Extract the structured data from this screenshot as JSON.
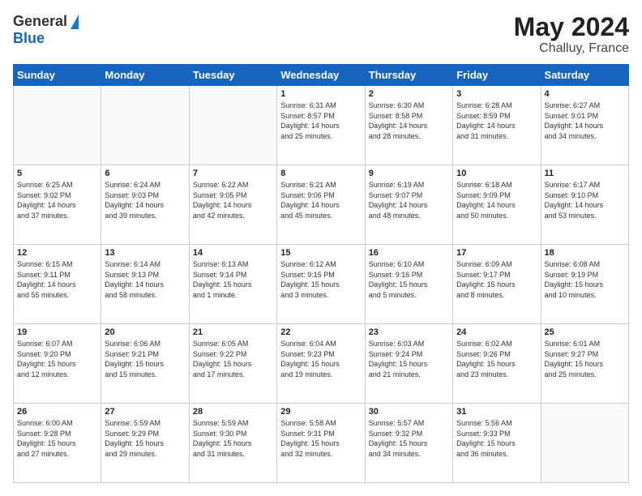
{
  "header": {
    "logo_general": "General",
    "logo_blue": "Blue",
    "month_year": "May 2024",
    "location": "Challuy, France"
  },
  "weekdays": [
    "Sunday",
    "Monday",
    "Tuesday",
    "Wednesday",
    "Thursday",
    "Friday",
    "Saturday"
  ],
  "weeks": [
    [
      {
        "day": "",
        "info": ""
      },
      {
        "day": "",
        "info": ""
      },
      {
        "day": "",
        "info": ""
      },
      {
        "day": "1",
        "info": "Sunrise: 6:31 AM\nSunset: 8:57 PM\nDaylight: 14 hours\nand 25 minutes."
      },
      {
        "day": "2",
        "info": "Sunrise: 6:30 AM\nSunset: 8:58 PM\nDaylight: 14 hours\nand 28 minutes."
      },
      {
        "day": "3",
        "info": "Sunrise: 6:28 AM\nSunset: 8:59 PM\nDaylight: 14 hours\nand 31 minutes."
      },
      {
        "day": "4",
        "info": "Sunrise: 6:27 AM\nSunset: 9:01 PM\nDaylight: 14 hours\nand 34 minutes."
      }
    ],
    [
      {
        "day": "5",
        "info": "Sunrise: 6:25 AM\nSunset: 9:02 PM\nDaylight: 14 hours\nand 37 minutes."
      },
      {
        "day": "6",
        "info": "Sunrise: 6:24 AM\nSunset: 9:03 PM\nDaylight: 14 hours\nand 39 minutes."
      },
      {
        "day": "7",
        "info": "Sunrise: 6:22 AM\nSunset: 9:05 PM\nDaylight: 14 hours\nand 42 minutes."
      },
      {
        "day": "8",
        "info": "Sunrise: 6:21 AM\nSunset: 9:06 PM\nDaylight: 14 hours\nand 45 minutes."
      },
      {
        "day": "9",
        "info": "Sunrise: 6:19 AM\nSunset: 9:07 PM\nDaylight: 14 hours\nand 48 minutes."
      },
      {
        "day": "10",
        "info": "Sunrise: 6:18 AM\nSunset: 9:09 PM\nDaylight: 14 hours\nand 50 minutes."
      },
      {
        "day": "11",
        "info": "Sunrise: 6:17 AM\nSunset: 9:10 PM\nDaylight: 14 hours\nand 53 minutes."
      }
    ],
    [
      {
        "day": "12",
        "info": "Sunrise: 6:15 AM\nSunset: 9:11 PM\nDaylight: 14 hours\nand 55 minutes."
      },
      {
        "day": "13",
        "info": "Sunrise: 6:14 AM\nSunset: 9:13 PM\nDaylight: 14 hours\nand 58 minutes."
      },
      {
        "day": "14",
        "info": "Sunrise: 6:13 AM\nSunset: 9:14 PM\nDaylight: 15 hours\nand 1 minute."
      },
      {
        "day": "15",
        "info": "Sunrise: 6:12 AM\nSunset: 9:15 PM\nDaylight: 15 hours\nand 3 minutes."
      },
      {
        "day": "16",
        "info": "Sunrise: 6:10 AM\nSunset: 9:16 PM\nDaylight: 15 hours\nand 5 minutes."
      },
      {
        "day": "17",
        "info": "Sunrise: 6:09 AM\nSunset: 9:17 PM\nDaylight: 15 hours\nand 8 minutes."
      },
      {
        "day": "18",
        "info": "Sunrise: 6:08 AM\nSunset: 9:19 PM\nDaylight: 15 hours\nand 10 minutes."
      }
    ],
    [
      {
        "day": "19",
        "info": "Sunrise: 6:07 AM\nSunset: 9:20 PM\nDaylight: 15 hours\nand 12 minutes."
      },
      {
        "day": "20",
        "info": "Sunrise: 6:06 AM\nSunset: 9:21 PM\nDaylight: 15 hours\nand 15 minutes."
      },
      {
        "day": "21",
        "info": "Sunrise: 6:05 AM\nSunset: 9:22 PM\nDaylight: 15 hours\nand 17 minutes."
      },
      {
        "day": "22",
        "info": "Sunrise: 6:04 AM\nSunset: 9:23 PM\nDaylight: 15 hours\nand 19 minutes."
      },
      {
        "day": "23",
        "info": "Sunrise: 6:03 AM\nSunset: 9:24 PM\nDaylight: 15 hours\nand 21 minutes."
      },
      {
        "day": "24",
        "info": "Sunrise: 6:02 AM\nSunset: 9:26 PM\nDaylight: 15 hours\nand 23 minutes."
      },
      {
        "day": "25",
        "info": "Sunrise: 6:01 AM\nSunset: 9:27 PM\nDaylight: 15 hours\nand 25 minutes."
      }
    ],
    [
      {
        "day": "26",
        "info": "Sunrise: 6:00 AM\nSunset: 9:28 PM\nDaylight: 15 hours\nand 27 minutes."
      },
      {
        "day": "27",
        "info": "Sunrise: 5:59 AM\nSunset: 9:29 PM\nDaylight: 15 hours\nand 29 minutes."
      },
      {
        "day": "28",
        "info": "Sunrise: 5:59 AM\nSunset: 9:30 PM\nDaylight: 15 hours\nand 31 minutes."
      },
      {
        "day": "29",
        "info": "Sunrise: 5:58 AM\nSunset: 9:31 PM\nDaylight: 15 hours\nand 32 minutes."
      },
      {
        "day": "30",
        "info": "Sunrise: 5:57 AM\nSunset: 9:32 PM\nDaylight: 15 hours\nand 34 minutes."
      },
      {
        "day": "31",
        "info": "Sunrise: 5:56 AM\nSunset: 9:33 PM\nDaylight: 15 hours\nand 36 minutes."
      },
      {
        "day": "",
        "info": ""
      }
    ]
  ]
}
